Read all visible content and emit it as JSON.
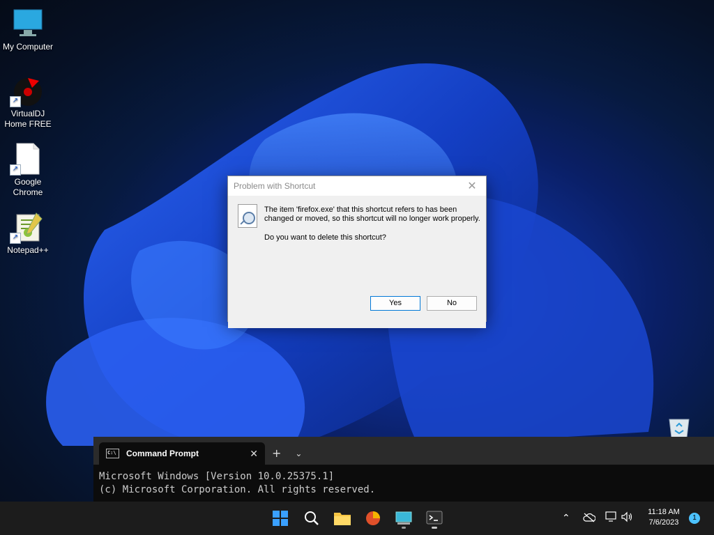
{
  "desktop": {
    "icons": [
      {
        "label": "My Computer"
      },
      {
        "label": "VirtualDJ\nHome FREE"
      },
      {
        "label": "Google\nChrome"
      },
      {
        "label": "Notepad++"
      }
    ]
  },
  "dialog": {
    "title": "Problem with Shortcut",
    "message": "The item 'firefox.exe' that this shortcut refers to has been changed or moved, so this shortcut will no longer work properly.",
    "question": "Do you want to delete this shortcut?",
    "yes_label": "Yes",
    "no_label": "No"
  },
  "terminal": {
    "tab_title": "Command Prompt",
    "new_tab": "+",
    "lines": [
      "Microsoft Windows [Version 10.0.25375.1]",
      "(c) Microsoft Corporation. All rights reserved."
    ]
  },
  "taskbar": {
    "clock_time": "11:18 AM",
    "clock_date": "7/6/2023",
    "notification_count": "1"
  },
  "colors": {
    "accent": "#0078d7",
    "taskbar_bg": "#1c1c1c",
    "notification_badge": "#4cc2ff"
  }
}
